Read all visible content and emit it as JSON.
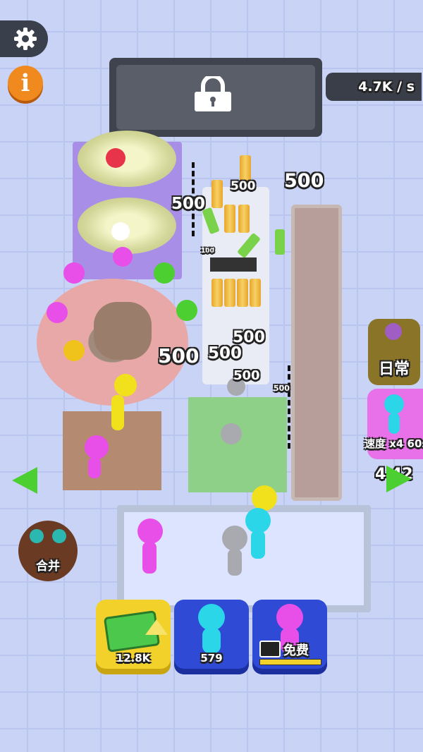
{
  "hud": {
    "settings_icon": "gear-icon",
    "info_label": "i",
    "lock_icon": "lock-icon",
    "income_rate": "4.7K / s"
  },
  "world": {
    "float_values": [
      "500",
      "500",
      "500",
      "500",
      "500",
      "500",
      "500",
      "500"
    ],
    "small_values": [
      "500",
      "500",
      "500",
      "100",
      "500"
    ]
  },
  "side": {
    "daily_label": "日常",
    "speed_label": "速度 x4 60s",
    "timer": "4   42"
  },
  "merge": {
    "label": "合并"
  },
  "bottom": {
    "money_value": "12.8K",
    "worker_value": "579",
    "free_label": "免费"
  },
  "colors": {
    "accent_green": "#4ccf30",
    "money_yellow": "#f2d22a",
    "button_blue": "#2f4bd6",
    "info_orange": "#f08a1e"
  }
}
